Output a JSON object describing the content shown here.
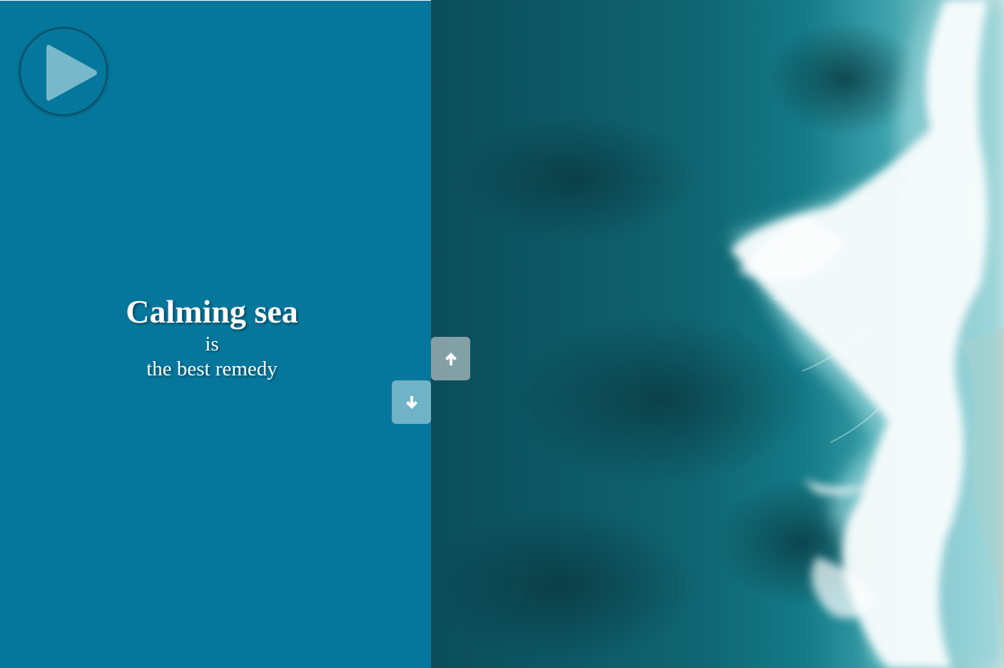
{
  "slide": {
    "title": "Calming sea",
    "line1": "is",
    "line2": "the best remedy"
  },
  "controls": {
    "play_icon": "play-icon",
    "up_icon": "arrow-up-icon",
    "down_icon": "arrow-down-icon"
  },
  "colors": {
    "panel_background": "#06779c",
    "sea_deep": "#0a4a55",
    "sea_mid": "#106a78",
    "foam": "#ffffff",
    "sand": "#d9d3c6"
  }
}
